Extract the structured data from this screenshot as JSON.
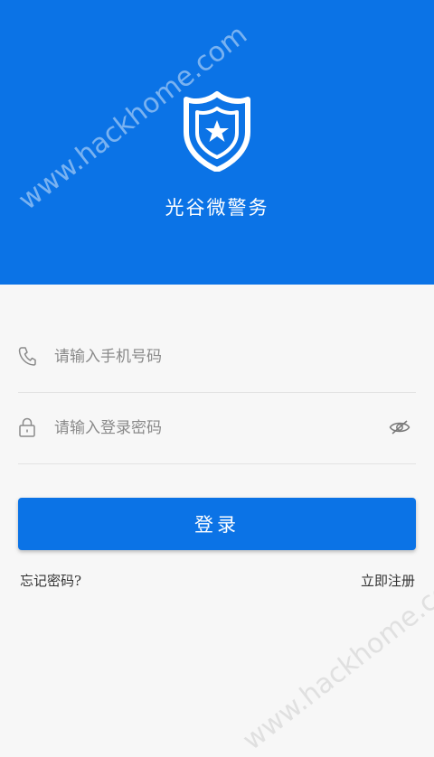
{
  "header": {
    "app_name": "光谷微警务",
    "badge_icon": "police-badge-star-icon",
    "background_color": "#0b73e6"
  },
  "watermark": "www.hackhome.com",
  "login_form": {
    "phone_placeholder": "请输入手机号码",
    "phone_icon": "phone-icon",
    "password_placeholder": "请输入登录密码",
    "password_icon": "lock-icon",
    "visibility_icon": "eye-slash-icon",
    "login_button_label": "登录",
    "forgot_password_label": "忘记密码?",
    "register_label": "立即注册"
  },
  "colors": {
    "accent": "#0b73e6",
    "page_background": "#f7f7f7"
  }
}
